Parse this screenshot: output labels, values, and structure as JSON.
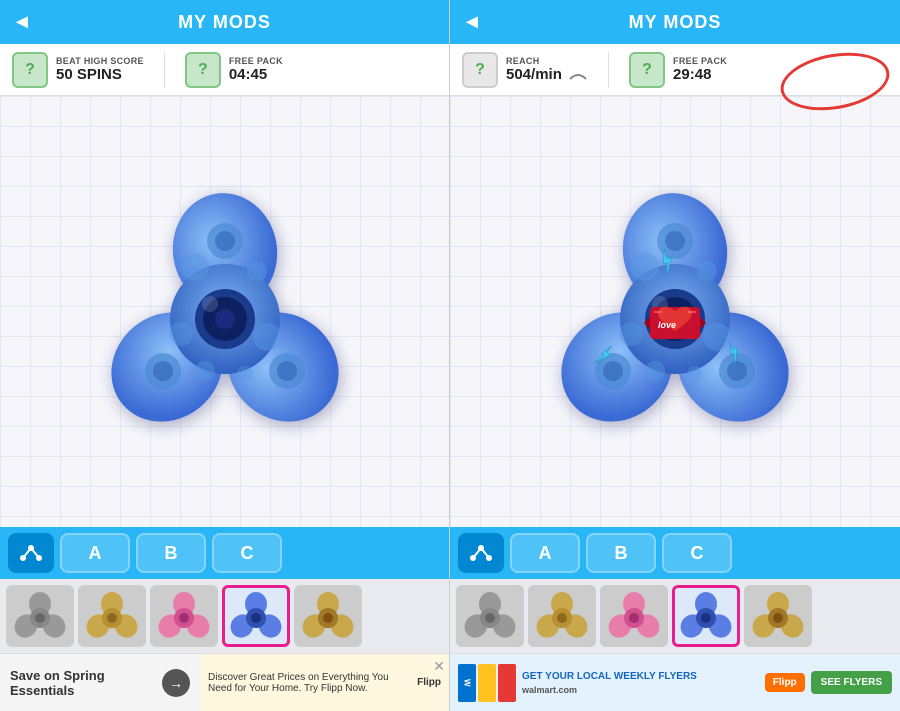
{
  "screens": [
    {
      "id": "screen-left",
      "header": {
        "title": "MY MODS",
        "back_label": "◄"
      },
      "stats": [
        {
          "icon": "?",
          "label": "BEAT HIGH SCORE",
          "value": "50 SPINS",
          "icon_type": "green"
        },
        {
          "icon": "?",
          "label": "FREE PACK",
          "value": "04:45",
          "icon_type": "green"
        }
      ],
      "tabs": [
        {
          "label": "share",
          "type": "share"
        },
        {
          "label": "A",
          "type": "letter"
        },
        {
          "label": "B",
          "type": "letter"
        },
        {
          "label": "C",
          "type": "letter"
        }
      ],
      "spinners": [
        {
          "color": "#888",
          "selected": false
        },
        {
          "color": "#c8a84b",
          "selected": false
        },
        {
          "color": "#e87daa",
          "selected": false
        },
        {
          "color": "#5b7ee5",
          "selected": true
        },
        {
          "color": "#c8a84b",
          "selected": false
        }
      ],
      "ad": {
        "left_text": "Save on Spring Essentials",
        "right_text": "Discover Great Prices on Everything You Need for Your Home. Try Flipp Now.",
        "sponsor": "Flipp"
      },
      "has_stickers": false
    },
    {
      "id": "screen-right",
      "header": {
        "title": "MY MODS",
        "back_label": "◄"
      },
      "stats": [
        {
          "icon": "?",
          "label": "REACH",
          "value": "504/min",
          "icon_type": "gray",
          "has_speed": true
        },
        {
          "icon": "?",
          "label": "FREE PACK",
          "value": "29:48",
          "icon_type": "green"
        }
      ],
      "tabs": [
        {
          "label": "share",
          "type": "share"
        },
        {
          "label": "A",
          "type": "letter"
        },
        {
          "label": "B",
          "type": "letter"
        },
        {
          "label": "C",
          "type": "letter"
        }
      ],
      "spinners": [
        {
          "color": "#888",
          "selected": false
        },
        {
          "color": "#c8a84b",
          "selected": false
        },
        {
          "color": "#e87daa",
          "selected": false
        },
        {
          "color": "#5b7ee5",
          "selected": true
        },
        {
          "color": "#c8a84b",
          "selected": false
        }
      ],
      "ad": {
        "left_text": "GET YOUR LOCAL WEEKLY FLYERS",
        "sponsor": "Flipp",
        "cta": "SEE FLYERS"
      },
      "has_stickers": true,
      "has_circle": true
    }
  ],
  "icons": {
    "share": "✦",
    "back": "◄",
    "arrow_right": "→",
    "close": "✕"
  }
}
